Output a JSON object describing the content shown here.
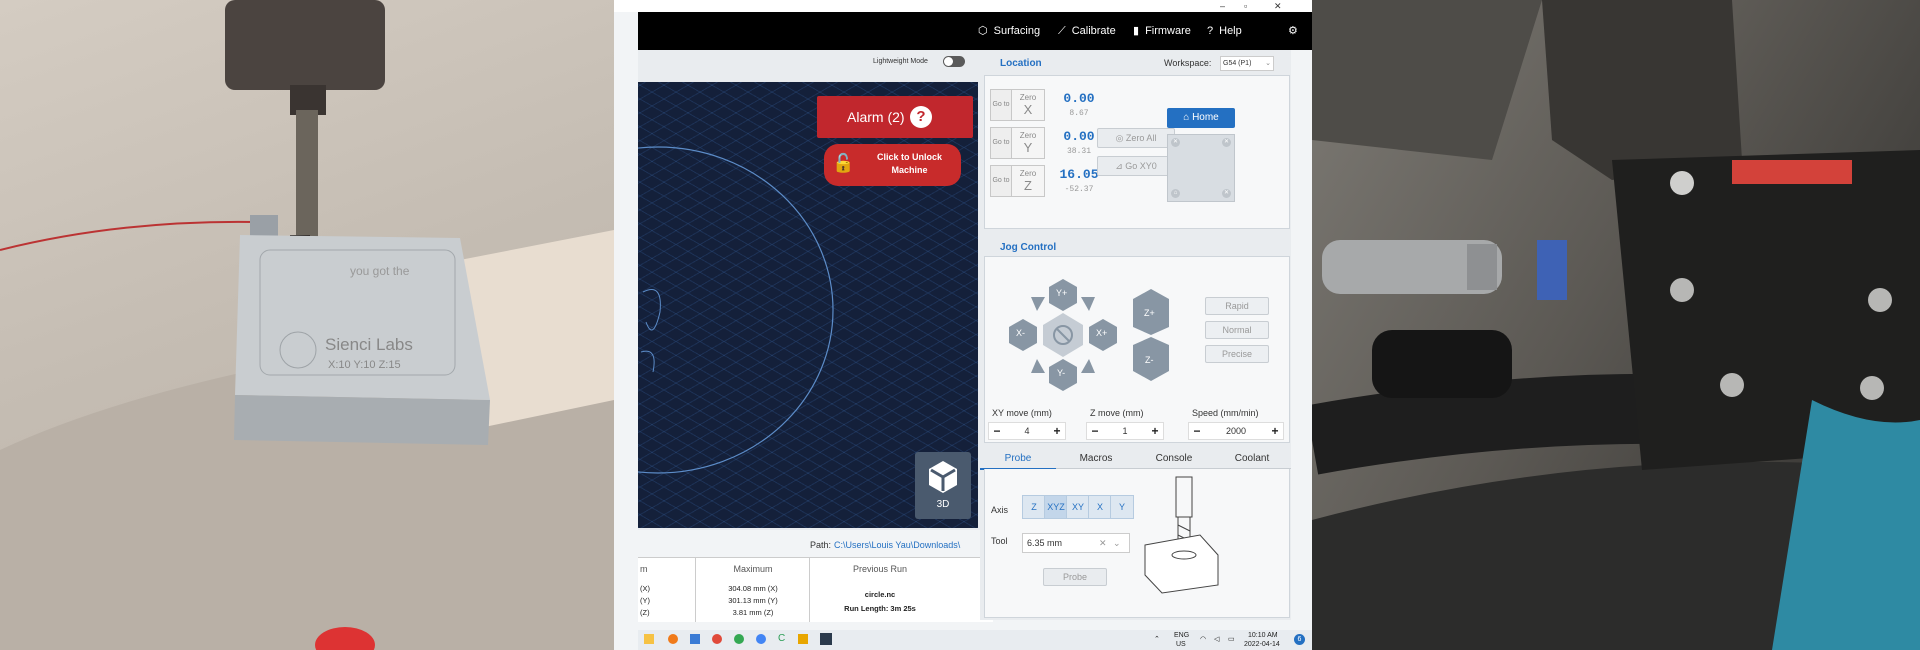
{
  "window": {
    "minimize": "–",
    "maximize": "▫",
    "close": "✕"
  },
  "nav": {
    "surfacing": "Surfacing",
    "calibrate": "Calibrate",
    "firmware": "Firmware",
    "help": "Help"
  },
  "visualizer": {
    "lightweight_label": "Lightweight Mode",
    "alarm_label": "Alarm (2)",
    "unlock_line1": "Click to Unlock",
    "unlock_line2": "Machine",
    "view_3d": "3D"
  },
  "file": {
    "path_label": "Path:",
    "path_value": "C:\\Users\\Louis Yau\\Downloads\\"
  },
  "stats": {
    "col1_header": "m",
    "col2_header": "Maximum",
    "col3_header": "Previous Run",
    "col1": [
      "(X)",
      "(Y)",
      "(Z)"
    ],
    "col2": [
      "304.08 mm (X)",
      "301.13 mm (Y)",
      "3.81 mm (Z)"
    ],
    "col3": [
      "circle.nc",
      "Run Length: 3m 25s"
    ]
  },
  "location": {
    "title": "Location",
    "workspace_label": "Workspace:",
    "workspace_value": "G54 (P1)",
    "go_label": "Go to",
    "zero_label": "Zero",
    "axes": [
      {
        "axis": "X",
        "value": "0.00",
        "machine": "8.67"
      },
      {
        "axis": "Y",
        "value": "0.00",
        "machine": "38.31"
      },
      {
        "axis": "Z",
        "value": "16.05",
        "machine": "-52.37"
      }
    ],
    "zero_all": "Zero All",
    "go_xy0": "Go XY0",
    "home": "Home"
  },
  "jog": {
    "title": "Jog Control",
    "y_plus": "Y+",
    "y_minus": "Y-",
    "x_plus": "X+",
    "x_minus": "X-",
    "z_plus": "Z+",
    "z_minus": "Z-",
    "rapid": "Rapid",
    "normal": "Normal",
    "precise": "Precise",
    "xy_move_label": "XY move (mm)",
    "xy_move_value": "4",
    "z_move_label": "Z move (mm)",
    "z_move_value": "1",
    "speed_label": "Speed (mm/min)",
    "speed_value": "2000",
    "minus": "−",
    "plus": "+"
  },
  "tabs": [
    "Probe",
    "Macros",
    "Console",
    "Coolant"
  ],
  "probe": {
    "axis_label": "Axis",
    "axis_options": [
      "Z",
      "XYZ",
      "XY",
      "X",
      "Y"
    ],
    "tool_label": "Tool",
    "tool_value": "6.35 mm",
    "clear": "✕",
    "probe_button": "Probe"
  },
  "photo_left": {
    "block_text": "Sienci Labs",
    "block_coords": "X:10 Y:10 Z:15",
    "engraving": "you got the"
  },
  "taskbar": {
    "lang": "ENG",
    "region": "US",
    "time": "10:10 AM",
    "date": "2022-04-14",
    "badge": "6"
  }
}
